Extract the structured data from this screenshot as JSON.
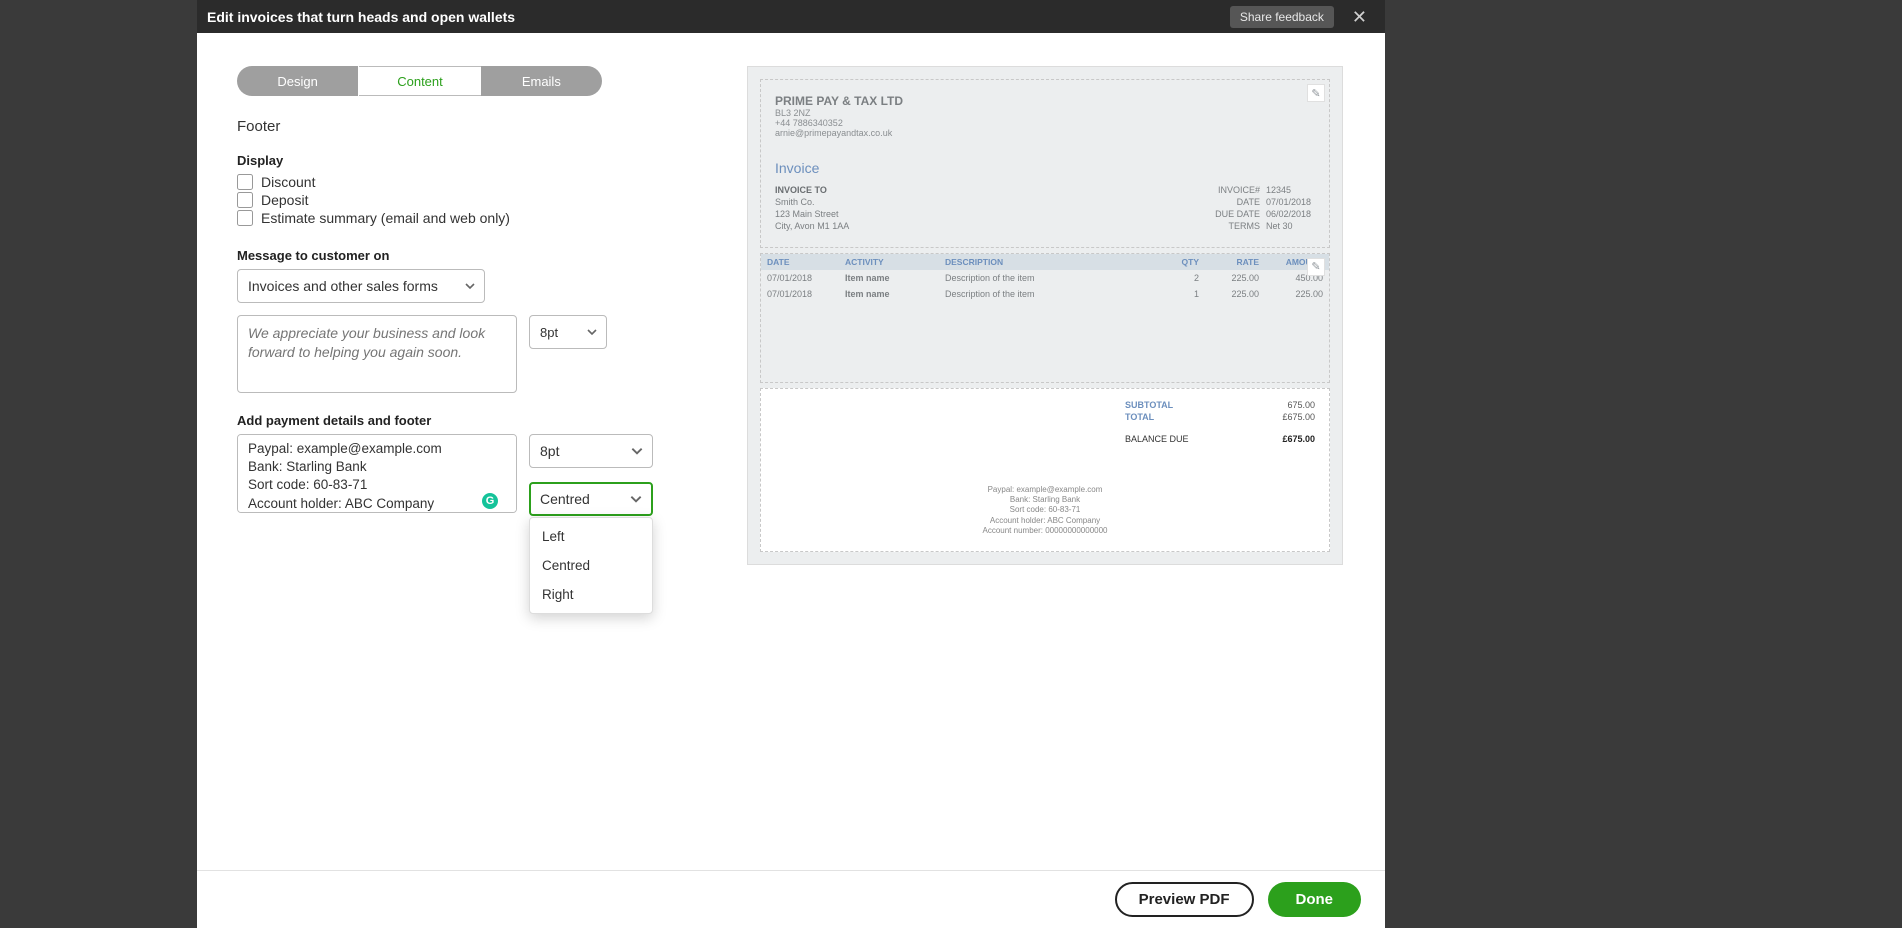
{
  "header": {
    "title": "Edit invoices that turn heads and open wallets",
    "share_feedback": "Share feedback"
  },
  "tabs": {
    "design": "Design",
    "content": "Content",
    "emails": "Emails"
  },
  "left": {
    "footer_heading": "Footer",
    "display_label": "Display",
    "checkboxes": {
      "discount": "Discount",
      "deposit": "Deposit",
      "estimate": "Estimate summary (email and web only)"
    },
    "message_label": "Message to customer on",
    "message_select_value": "Invoices and other sales forms",
    "message_placeholder": "We appreciate your business and look forward to helping you again soon.",
    "message_font_size": "8pt",
    "payment_label": "Add payment details and footer",
    "payment_text": "Paypal: example@example.com\nBank: Starling Bank\nSort code: 60-83-71\nAccount holder: ABC Company\nAccount number: 00000000000000",
    "payment_font_size": "8pt",
    "alignment_value": "Centred",
    "alignment_options": [
      "Left",
      "Centred",
      "Right"
    ]
  },
  "preview": {
    "company": {
      "name": "PRIME PAY & TAX LTD",
      "line1": "BL3 2NZ",
      "line2": "+44 7886340352",
      "line3": "arnie@primepayandtax.co.uk"
    },
    "invoice_title": "Invoice",
    "billto": {
      "heading": "INVOICE TO",
      "l1": "Smith Co.",
      "l2": "123 Main Street",
      "l3": "City, Avon M1 1AA"
    },
    "meta": [
      {
        "label": "INVOICE#",
        "value": "12345"
      },
      {
        "label": "DATE",
        "value": "07/01/2018"
      },
      {
        "label": "DUE DATE",
        "value": "06/02/2018"
      },
      {
        "label": "TERMS",
        "value": "Net 30"
      }
    ],
    "columns": {
      "date": "DATE",
      "activity": "ACTIVITY",
      "description": "DESCRIPTION",
      "qty": "QTY",
      "rate": "RATE",
      "amount": "AMOUNT"
    },
    "rows": [
      {
        "date": "07/01/2018",
        "activity": "Item name",
        "description": "Description of the item",
        "qty": "2",
        "rate": "225.00",
        "amount": "450.00"
      },
      {
        "date": "07/01/2018",
        "activity": "Item name",
        "description": "Description of the item",
        "qty": "1",
        "rate": "225.00",
        "amount": "225.00"
      }
    ],
    "totals": {
      "subtotal_label": "SUBTOTAL",
      "subtotal_value": "675.00",
      "total_label": "TOTAL",
      "total_value": "£675.00",
      "balance_label": "BALANCE DUE",
      "balance_value": "£675.00"
    },
    "footer_lines": [
      "Paypal: example@example.com",
      "Bank: Starling Bank",
      "Sort code: 60-83-71",
      "Account holder: ABC Company",
      "Account number: 00000000000000"
    ]
  },
  "bottom": {
    "preview_pdf": "Preview PDF",
    "done": "Done"
  }
}
